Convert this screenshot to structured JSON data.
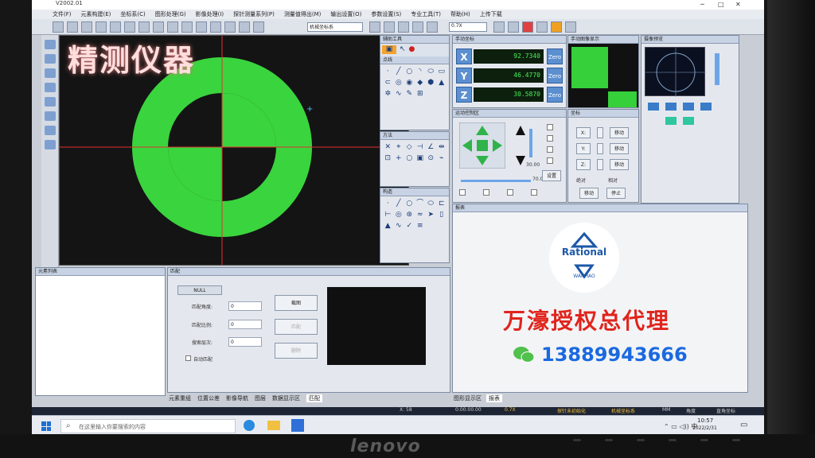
{
  "window": {
    "title": "V2002.01"
  },
  "menu": [
    "文件(F)",
    "元素构建(E)",
    "坐标系(C)",
    "图形处理(G)",
    "影像处理(I)",
    "探针测量系列(P)",
    "测量值得出(M)",
    "输出设置(O)",
    "参数设置(S)",
    "专业工具(T)",
    "帮助(H)",
    "上传下载"
  ],
  "toolbar": {
    "coord_select": "机械坐标系",
    "zoom_select": "0.7X"
  },
  "watermark": "精测仪器",
  "panels": {
    "draw_tools": "辅助工具",
    "element_mode": "点线",
    "measure_mode": "方法",
    "construct": "构造",
    "dro": "手动坐标",
    "thumb": "手动图像显示",
    "joystick": "运动控制区",
    "coords": "坐标",
    "mini_cam": "摄像预览",
    "element_list": "元素列表",
    "match": "匹配",
    "report": "报表"
  },
  "dro": {
    "x_axis": "X",
    "x_value": "92.7340",
    "y_axis": "Y",
    "y_value": "46.4770",
    "z_axis": "Z",
    "z_value": "30.5870",
    "zero_label": "Zero"
  },
  "joystick": {
    "speed1": "30.00",
    "speed2": "70.00",
    "set_btn": "设置"
  },
  "coords_panel": {
    "x_lbl": "X:",
    "y_lbl": "Y:",
    "z_lbl": "Z:",
    "move_lbl": "移动",
    "go_btn": "移动",
    "stop_btn": "停止",
    "abs_lbl": "绝对",
    "rel_lbl": "相对"
  },
  "match": {
    "null_label": "NULL",
    "angle_lbl": "匹配角度:",
    "scale_lbl": "匹配比例:",
    "count_lbl": "搜索层次:",
    "angle_val": "0",
    "scale_val": "0",
    "count_val": "0",
    "btn1": "截图",
    "btn2": "匹配",
    "btn3": "删除",
    "auto_lbl": "自动匹配"
  },
  "bottom_tabs": [
    "元素重组",
    "位置公差",
    "影像导航",
    "图层",
    "数据显示区",
    "匹配"
  ],
  "report_tabs": [
    "图形显示区",
    "报表"
  ],
  "status": {
    "coord": "X: 58",
    "time": "0:00:00.00",
    "zoom": "0.7X",
    "mode1": "探针未初始化",
    "mode2": "机械坐标系",
    "unit": "MM",
    "angle": "角度",
    "dir": "直角坐标"
  },
  "taskbar": {
    "search_placeholder": "在这里输入你要搜索的内容",
    "clock": "10:57",
    "date": "2022/2/31"
  },
  "ad": {
    "company_logo": "Rational",
    "company_sub": "WANHAO",
    "headline": "万濠授权总代理",
    "phone": "13889943666"
  },
  "monitor_brand": "lenovo",
  "colors": {
    "green": "#35d03a",
    "red_text": "#e0241c",
    "blue_text": "#1a69e0"
  }
}
